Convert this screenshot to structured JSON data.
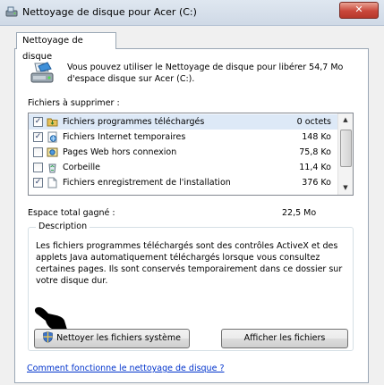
{
  "window": {
    "title": "Nettoyage de disque pour Acer (C:)",
    "close_label": "✕"
  },
  "tab": {
    "label": "Nettoyage de disque"
  },
  "intro_text": "Vous pouvez utiliser le Nettoyage de disque pour libérer 54,7 Mo d'espace disque sur Acer (C:).",
  "files_label": "Fichiers à supprimer :",
  "files": [
    {
      "name": "Fichiers programmes téléchargés",
      "size": "0 octets",
      "checked": true,
      "icon": "download-folder-icon"
    },
    {
      "name": "Fichiers Internet temporaires",
      "size": "148 Ko",
      "checked": true,
      "icon": "internet-files-icon"
    },
    {
      "name": "Pages Web hors connexion",
      "size": "75,8 Ko",
      "checked": false,
      "icon": "offline-pages-icon"
    },
    {
      "name": "Corbeille",
      "size": "11,4 Ko",
      "checked": false,
      "icon": "recycle-bin-icon"
    },
    {
      "name": "Fichiers enregistrement de l'installation",
      "size": "376 Ko",
      "checked": true,
      "icon": "document-icon"
    }
  ],
  "total_label": "Espace total gagné :",
  "total_value": "22,5 Mo",
  "description": {
    "title": "Description",
    "text": "Les fichiers programmes téléchargés sont des contrôles ActiveX et des applets Java automatiquement téléchargés lorsque vous consultez certaines pages. Ils sont conservés temporairement dans ce dossier sur votre disque dur."
  },
  "buttons": {
    "clean_system": "Nettoyer les fichiers système",
    "show_files": "Afficher les fichiers"
  },
  "help_link": "Comment fonctionne le nettoyage de disque ?",
  "colors": {
    "link": "#0033cc",
    "close": "#c9473a",
    "selection": "#dde9f7"
  }
}
